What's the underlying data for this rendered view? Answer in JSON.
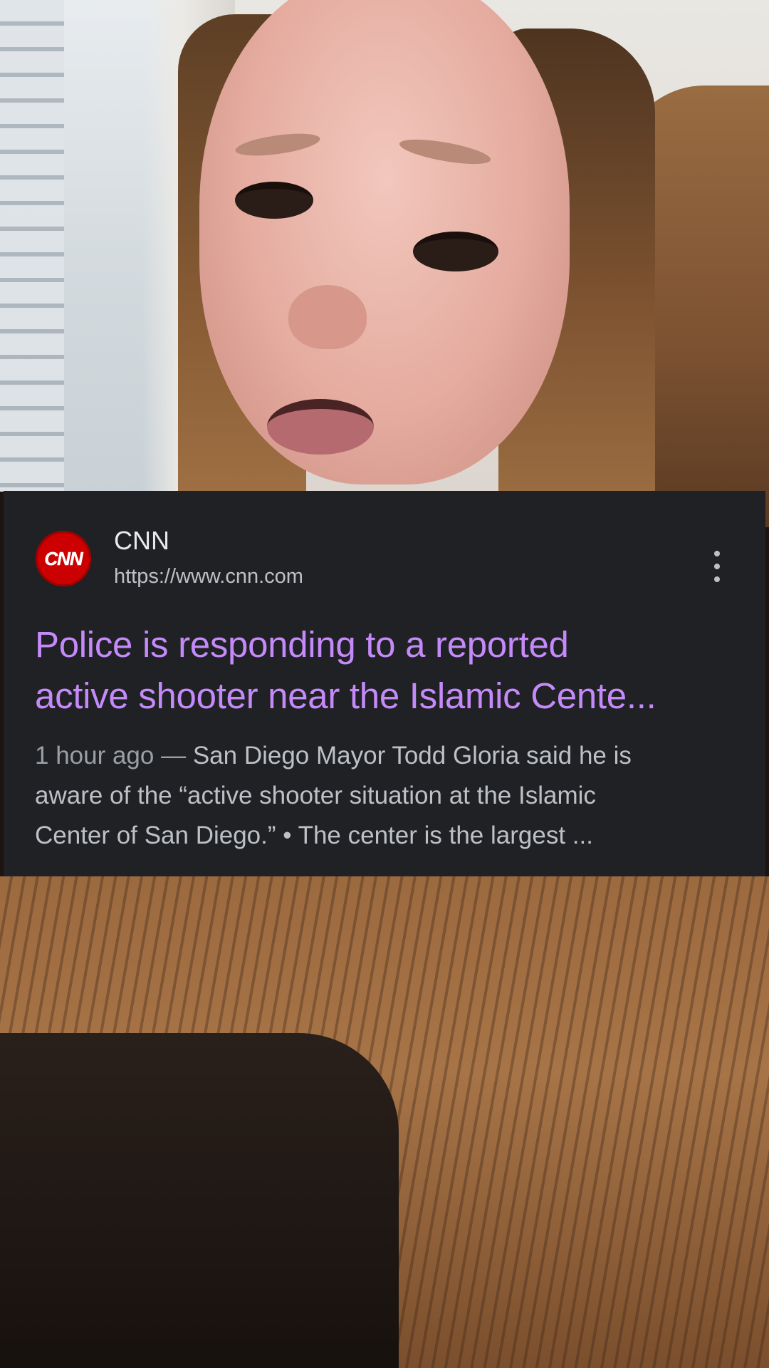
{
  "result": {
    "source": {
      "name": "CNN",
      "url": "https://www.cnn.com",
      "logo_text": "CNN",
      "logo_color": "#cc0000"
    },
    "title_lines": [
      "Police is responding to a reported",
      "active shooter near the Islamic Cente..."
    ],
    "snippet": {
      "date": "1 hour ago",
      "separator": " — ",
      "line1": "San Diego Mayor Todd Gloria said he is",
      "line2": "aware of the “active shooter situation at the Islamic",
      "line3": "Center of San Diego.” • The center is the largest ..."
    },
    "menu_icon": "more-vert-icon",
    "colors": {
      "card_background": "#202124",
      "title": "#c58af9",
      "text": "#bdc1c6"
    }
  }
}
